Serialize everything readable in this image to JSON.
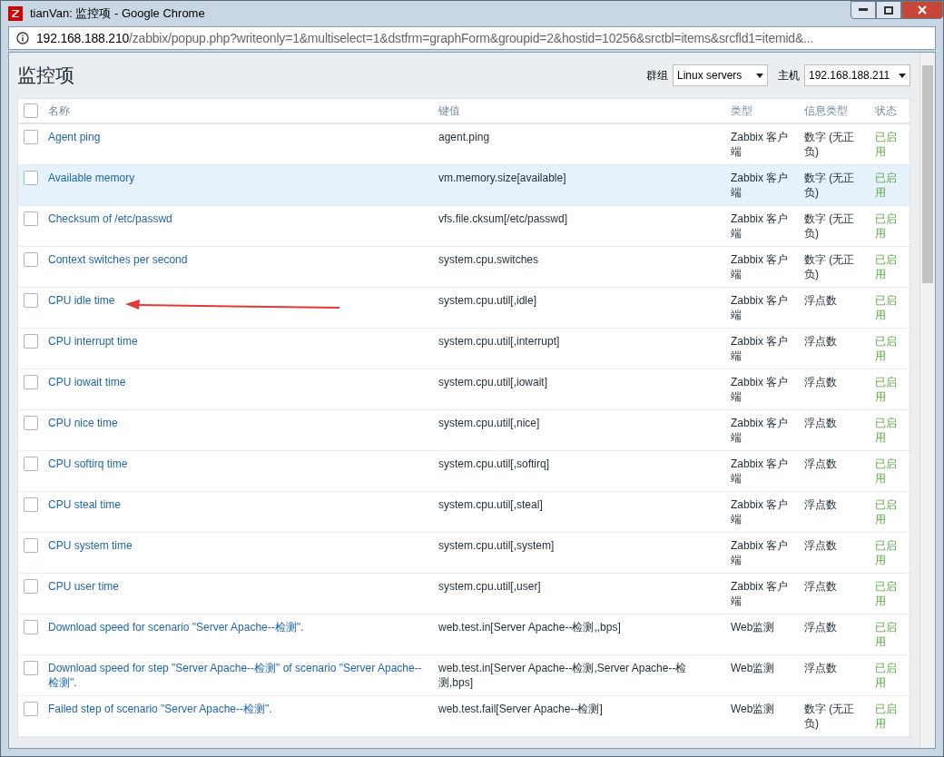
{
  "window": {
    "title": "tianVan: 监控项 - Google Chrome"
  },
  "address_bar": {
    "host": "192.168.188.210",
    "path": "/zabbix/popup.php?writeonly=1&multiselect=1&dstfrm=graphForm&groupid=2&hostid=10256&srctbl=items&srcfld1=itemid&..."
  },
  "page": {
    "title": "监控项",
    "group_label": "群组",
    "group_value": "Linux servers",
    "host_label": "主机",
    "host_value": "192.168.188.211"
  },
  "table": {
    "select_all_checked": false,
    "columns": [
      "名称",
      "键值",
      "类型",
      "信息类型",
      "状态"
    ],
    "rows": [
      {
        "name": "Agent ping",
        "key": "agent.ping",
        "type": "Zabbix 客户端",
        "info_type": "数字 (无正负)",
        "status": "已启用",
        "checked": false,
        "highlighted": false
      },
      {
        "name": "Available memory",
        "key": "vm.memory.size[available]",
        "type": "Zabbix 客户端",
        "info_type": "数字 (无正负)",
        "status": "已启用",
        "checked": false,
        "highlighted": true
      },
      {
        "name": "Checksum of /etc/passwd",
        "key": "vfs.file.cksum[/etc/passwd]",
        "type": "Zabbix 客户端",
        "info_type": "数字 (无正负)",
        "status": "已启用",
        "checked": false,
        "highlighted": false
      },
      {
        "name": "Context switches per second",
        "key": "system.cpu.switches",
        "type": "Zabbix 客户端",
        "info_type": "数字 (无正负)",
        "status": "已启用",
        "checked": false,
        "highlighted": false
      },
      {
        "name": "CPU idle time",
        "key": "system.cpu.util[,idle]",
        "type": "Zabbix 客户端",
        "info_type": "浮点数",
        "status": "已启用",
        "checked": false,
        "highlighted": false,
        "annotated": true
      },
      {
        "name": "CPU interrupt time",
        "key": "system.cpu.util[,interrupt]",
        "type": "Zabbix 客户端",
        "info_type": "浮点数",
        "status": "已启用",
        "checked": false,
        "highlighted": false
      },
      {
        "name": "CPU iowait time",
        "key": "system.cpu.util[,iowait]",
        "type": "Zabbix 客户端",
        "info_type": "浮点数",
        "status": "已启用",
        "checked": false,
        "highlighted": false
      },
      {
        "name": "CPU nice time",
        "key": "system.cpu.util[,nice]",
        "type": "Zabbix 客户端",
        "info_type": "浮点数",
        "status": "已启用",
        "checked": false,
        "highlighted": false
      },
      {
        "name": "CPU softirq time",
        "key": "system.cpu.util[,softirq]",
        "type": "Zabbix 客户端",
        "info_type": "浮点数",
        "status": "已启用",
        "checked": false,
        "highlighted": false
      },
      {
        "name": "CPU steal time",
        "key": "system.cpu.util[,steal]",
        "type": "Zabbix 客户端",
        "info_type": "浮点数",
        "status": "已启用",
        "checked": false,
        "highlighted": false
      },
      {
        "name": "CPU system time",
        "key": "system.cpu.util[,system]",
        "type": "Zabbix 客户端",
        "info_type": "浮点数",
        "status": "已启用",
        "checked": false,
        "highlighted": false
      },
      {
        "name": "CPU user time",
        "key": "system.cpu.util[,user]",
        "type": "Zabbix 客户端",
        "info_type": "浮点数",
        "status": "已启用",
        "checked": false,
        "highlighted": false
      },
      {
        "name": "Download speed for scenario \"Server Apache--检测\".",
        "key": "web.test.in[Server Apache--检测,,bps]",
        "type": "Web监测",
        "info_type": "浮点数",
        "status": "已启用",
        "checked": false,
        "highlighted": false
      },
      {
        "name": "Download speed for step \"Server Apache--检测\" of scenario \"Server Apache--检测\".",
        "key": "web.test.in[Server Apache--检测,Server Apache--检测,bps]",
        "type": "Web监测",
        "info_type": "浮点数",
        "status": "已启用",
        "checked": false,
        "highlighted": false
      },
      {
        "name": "Failed step of scenario \"Server Apache--检测\".",
        "key": "web.test.fail[Server Apache--检测]",
        "type": "Web监测",
        "info_type": "数字 (无正负)",
        "status": "已启用",
        "checked": false,
        "highlighted": false
      }
    ]
  }
}
